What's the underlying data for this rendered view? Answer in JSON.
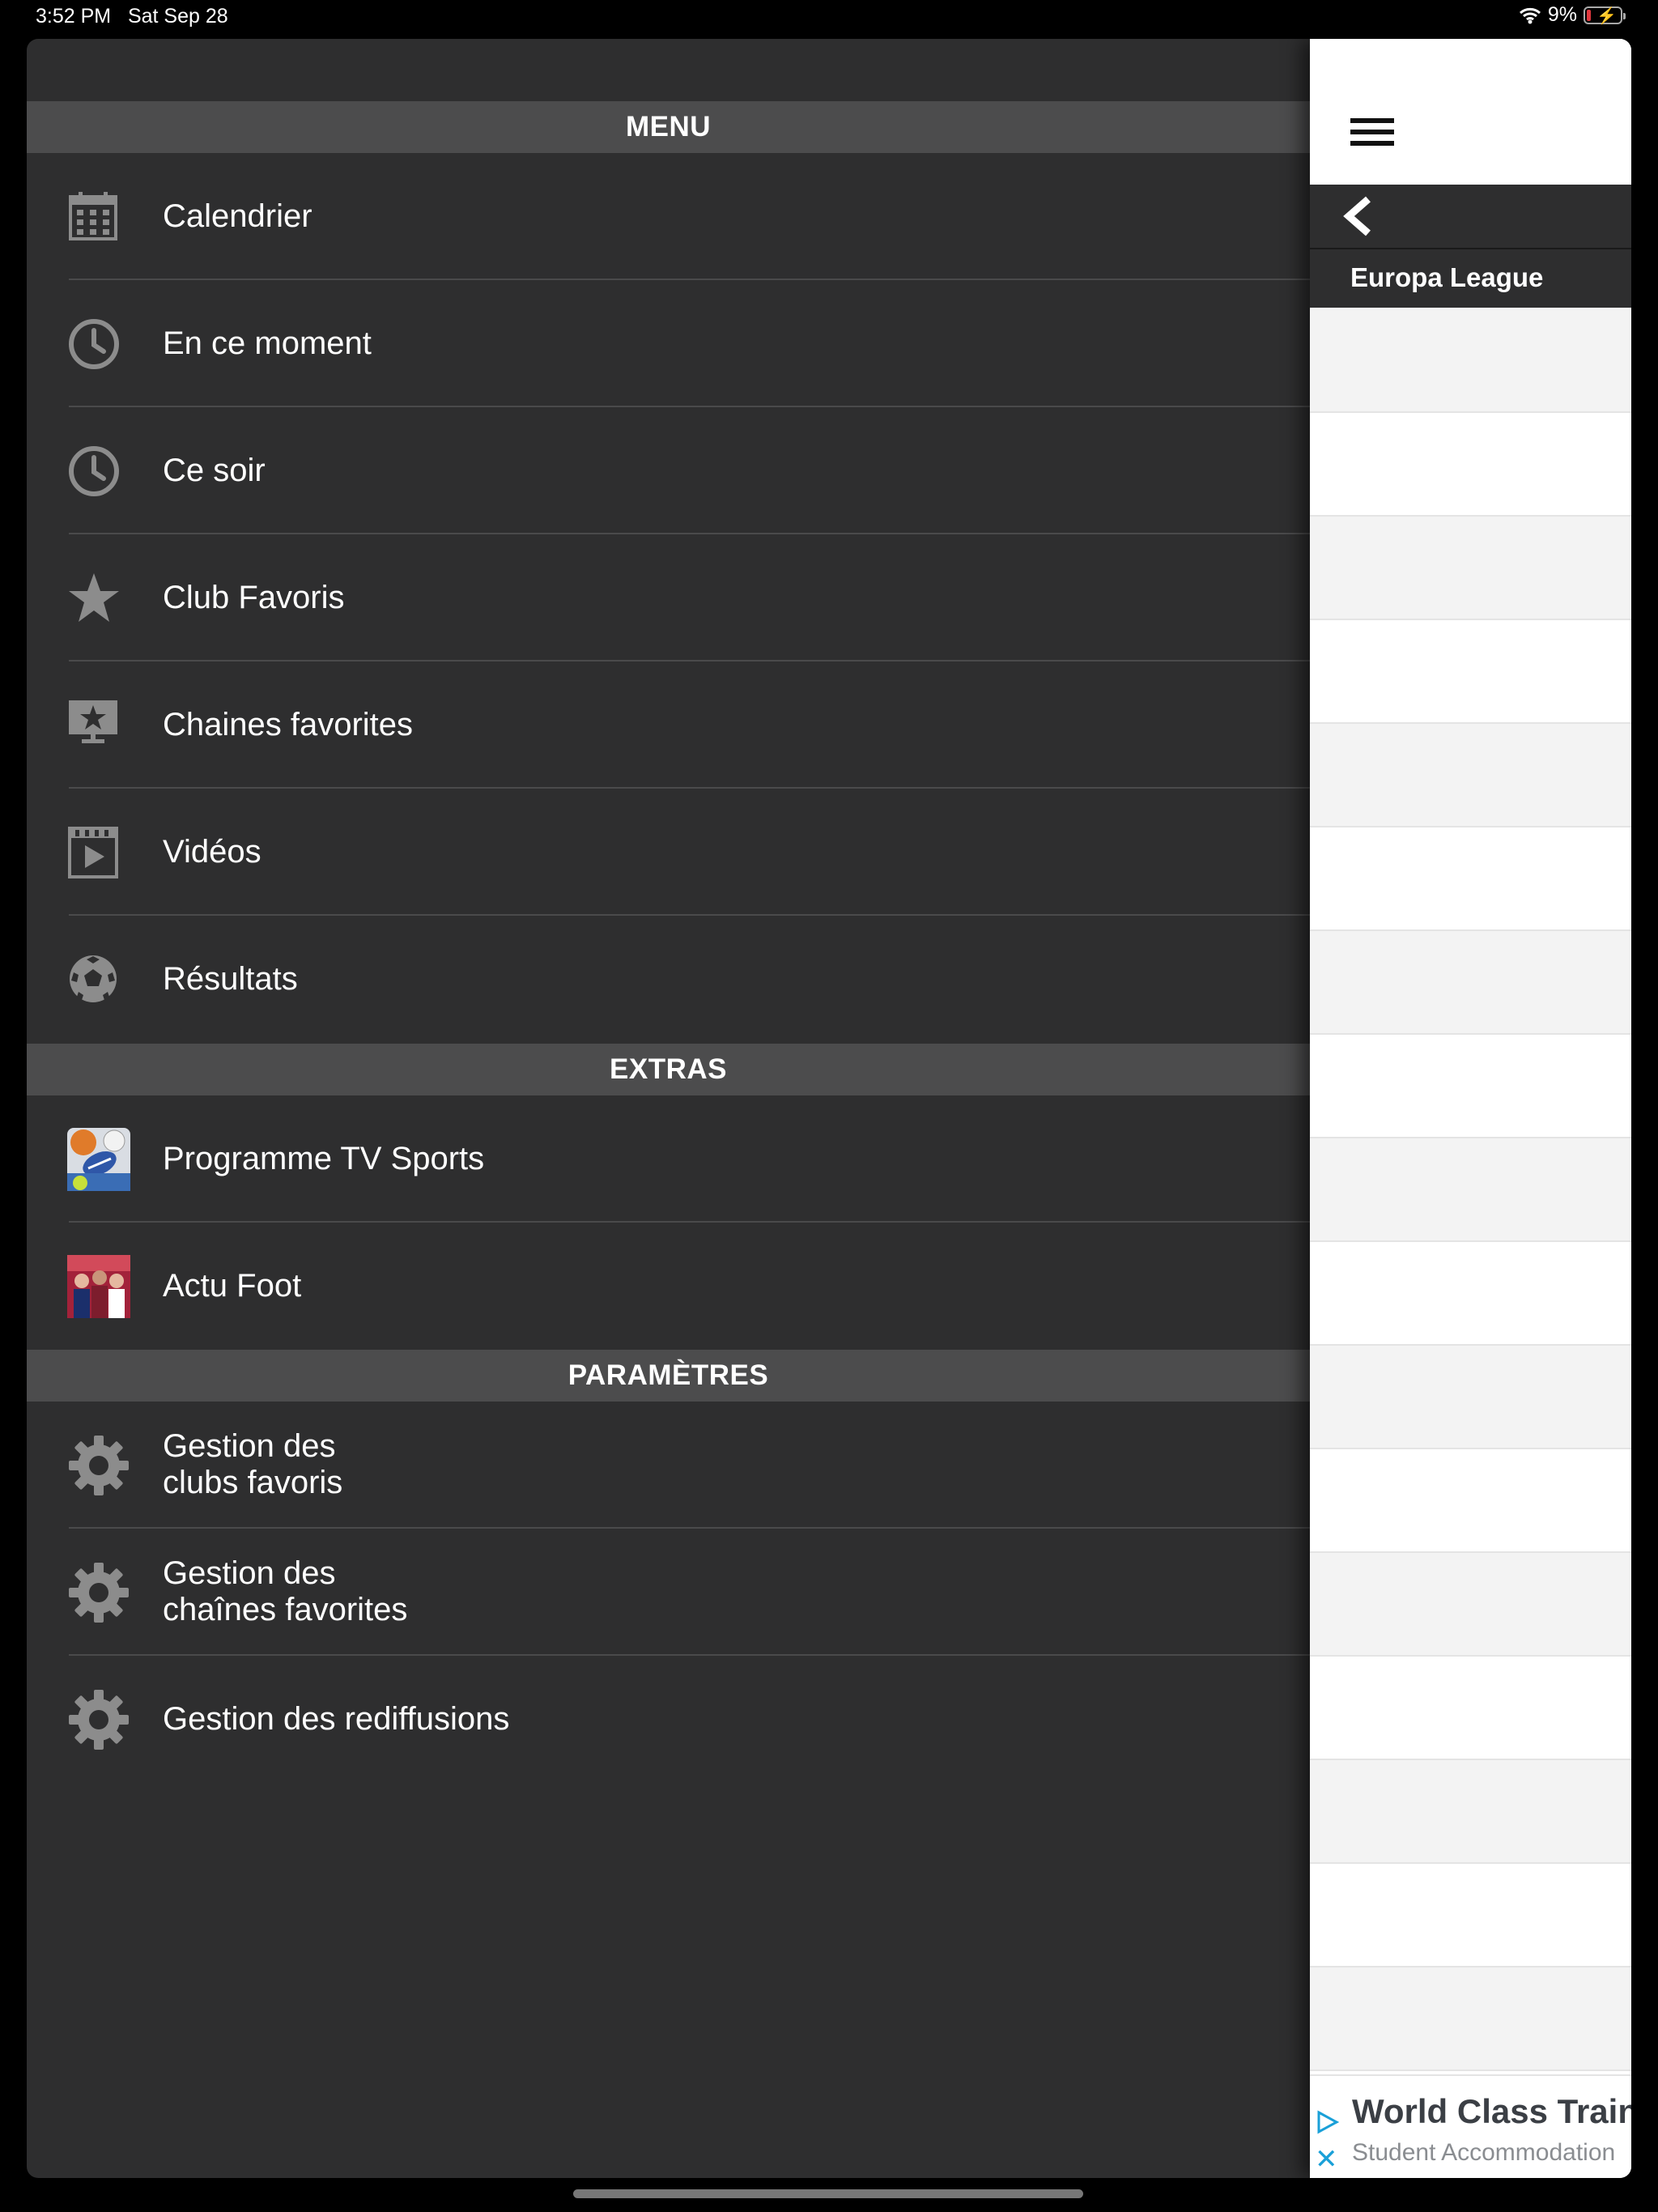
{
  "status_bar": {
    "time": "3:52 PM",
    "date": "Sat Sep 28",
    "battery": "9%"
  },
  "menu": {
    "section_menu": "MENU",
    "items": [
      {
        "label": "Calendrier",
        "icon": "calendar-icon"
      },
      {
        "label": "En ce moment",
        "icon": "clock-icon"
      },
      {
        "label": "Ce soir",
        "icon": "clock-icon"
      },
      {
        "label": "Club Favoris",
        "icon": "star-icon"
      },
      {
        "label": "Chaines favorites",
        "icon": "tv-star-icon"
      },
      {
        "label": "Vidéos",
        "icon": "video-icon"
      },
      {
        "label": "Résultats",
        "icon": "soccer-ball-icon"
      }
    ],
    "section_extras": "EXTRAS",
    "extras": [
      {
        "label": "Programme TV Sports",
        "icon": "programme-tv-sports-app-icon"
      },
      {
        "label": "Actu Foot",
        "icon": "actu-foot-app-icon"
      }
    ],
    "section_settings": "PARAMÈTRES",
    "settings": [
      {
        "line1": "Gestion des",
        "line2": "clubs favoris",
        "icon": "gear-icon"
      },
      {
        "line1": "Gestion des",
        "line2": "chaînes favorites",
        "icon": "gear-icon"
      },
      {
        "line1": "Gestion des rediffusions",
        "icon": "gear-icon"
      }
    ]
  },
  "content": {
    "league": "Europa League",
    "ad": {
      "title": "World Class Training",
      "subtitle": "Student Accommodation"
    }
  }
}
